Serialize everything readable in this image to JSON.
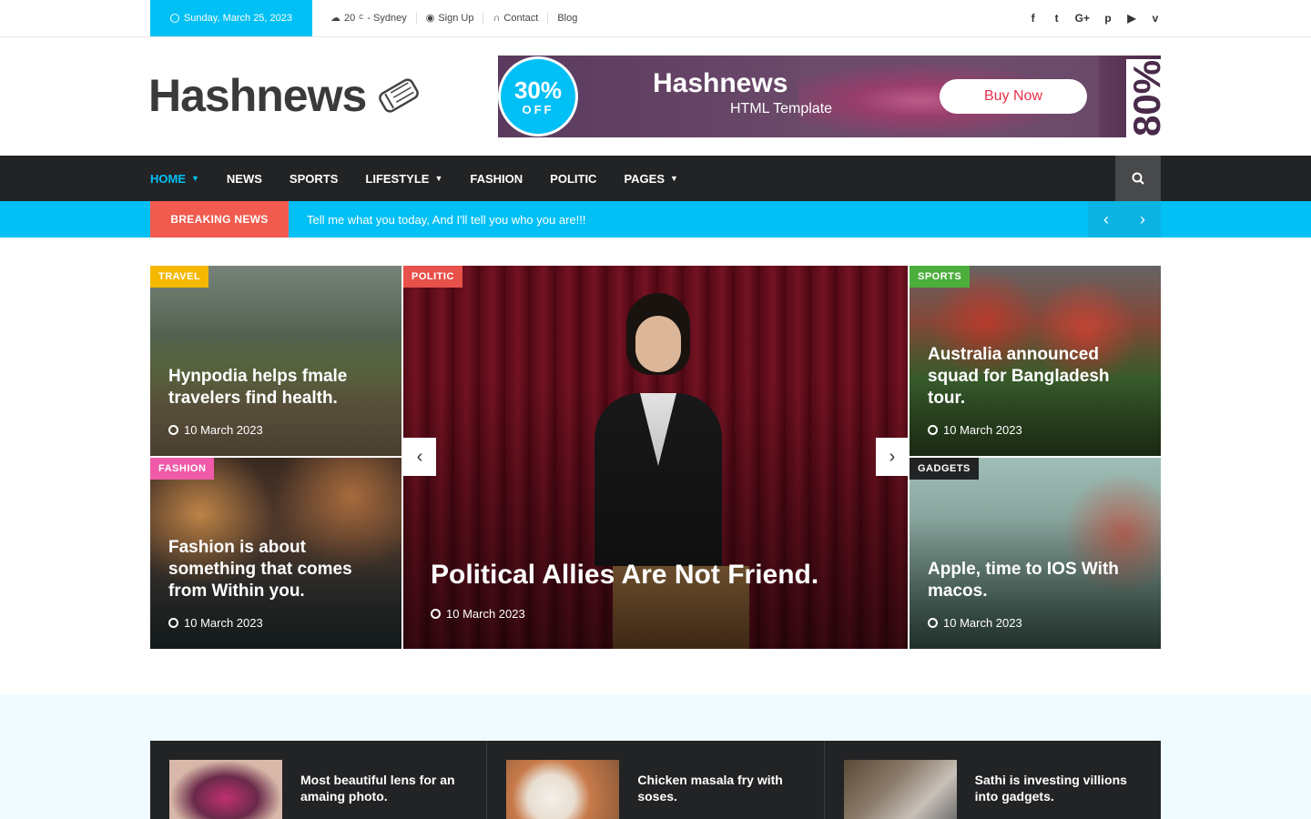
{
  "topbar": {
    "date": "Sunday, March 25, 2023",
    "weather": "20",
    "weather_unit": "C",
    "location": "- Sydney",
    "signup": "Sign Up",
    "contact": "Contact",
    "blog": "Blog",
    "social": [
      "f",
      "t",
      "G+",
      "p",
      "▶",
      "v"
    ]
  },
  "header": {
    "logo": "Hashnews",
    "banner": {
      "percent": "30%",
      "off": "OFF",
      "title": "Hashnews",
      "subtitle": "HTML Template",
      "button": "Buy Now",
      "big": "80%"
    }
  },
  "nav": {
    "items": [
      "HOME",
      "NEWS",
      "SPORTS",
      "LIFESTYLE",
      "FASHION",
      "POLITIC",
      "PAGES"
    ]
  },
  "breaking": {
    "label": "BREAKING NEWS",
    "text": "Tell me what you today, And I'll tell you who you are!!!"
  },
  "cards": [
    {
      "tag": "TRAVEL",
      "title": "Hynpodia helps fmale travelers find health.",
      "date": "10 March 2023"
    },
    {
      "tag": "FASHION",
      "title": "Fashion is about something that comes from Within you.",
      "date": "10 March 2023"
    },
    {
      "tag": "POLITIC",
      "title": "Political Allies Are Not Friend.",
      "date": "10 March 2023"
    },
    {
      "tag": "SPORTS",
      "title": "Australia announced squad for Bangladesh tour.",
      "date": "10 March 2023"
    },
    {
      "tag": "GADGETS",
      "title": "Apple, time to IOS With macos.",
      "date": "10 March 2023"
    }
  ],
  "strip": [
    {
      "title": "Most beautiful lens for an amaing photo."
    },
    {
      "title": "Chicken masala fry with soses."
    },
    {
      "title": "Sathi is investing villions into gadgets."
    }
  ],
  "colors": {
    "accent": "#00c0f5",
    "breaking_label": "#f15a4e",
    "travel": "#f5b800",
    "fashion": "#f05aa8",
    "politic": "#e8504a",
    "sports": "#4caf3c",
    "gadgets": "#222325"
  }
}
